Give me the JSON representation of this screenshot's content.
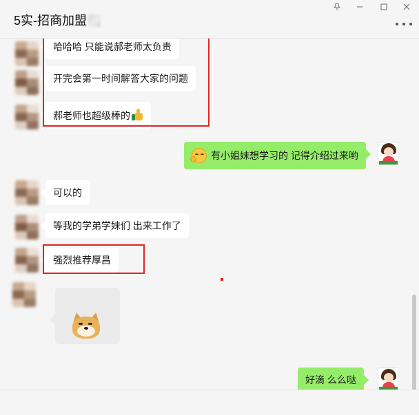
{
  "window": {
    "title": "5实-招商加盟",
    "controls": [
      "pin-icon",
      "minimize-icon",
      "maximize-icon",
      "close-icon"
    ],
    "more_icon": "more-dots-icon"
  },
  "messages": {
    "m1": "哈哈哈  只能说郝老师太负责",
    "m2": "开完会第一时间解答大家的问题",
    "m3": "郝老师也超级棒的",
    "m4": "有小姐妹想学习的  记得介绍过来哟",
    "m5": "可以的",
    "m6": "等我的学弟学妹们  出来工作了",
    "m7": "强烈推荐厚昌",
    "m9": "好滴   么么哒"
  },
  "colors": {
    "self_bubble": "#95ec69",
    "other_bubble": "#ffffff",
    "highlight_box": "#e02424",
    "background": "#f5f5f5"
  }
}
